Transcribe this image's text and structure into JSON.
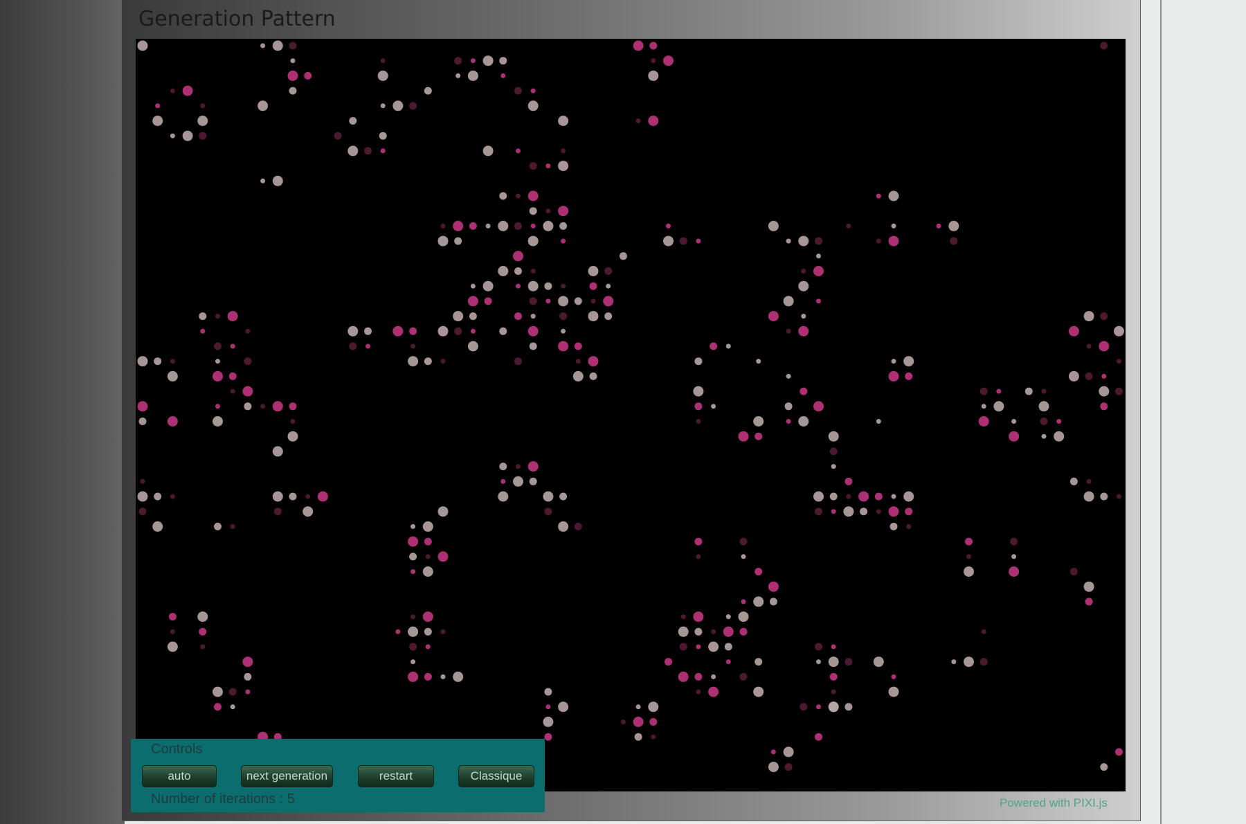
{
  "panel": {
    "title": "Generation Pattern"
  },
  "controls": {
    "title": "Controls",
    "buttons": {
      "auto": "auto",
      "next": "next generation",
      "restart": "restart",
      "mode": "Classique"
    },
    "iterations_label": "Number of iterations : 5"
  },
  "footer": {
    "powered": "Powered with PIXI.js"
  },
  "colors": {
    "board": "#000000",
    "controls_bg": "#0b6d6d",
    "cell_grey": "#b8a6a6",
    "cell_pink": "#c0357f",
    "cell_dark": "#5a1d3a"
  },
  "cells": [
    [
      0,
      0
    ],
    [
      8,
      0
    ],
    [
      9,
      0
    ],
    [
      10,
      0
    ],
    [
      33,
      0
    ],
    [
      34,
      0
    ],
    [
      64,
      0
    ],
    [
      10,
      1
    ],
    [
      16,
      1
    ],
    [
      21,
      1
    ],
    [
      22,
      1
    ],
    [
      23,
      1
    ],
    [
      24,
      1
    ],
    [
      34,
      1
    ],
    [
      35,
      1
    ],
    [
      10,
      2
    ],
    [
      11,
      2
    ],
    [
      16,
      2
    ],
    [
      21,
      2
    ],
    [
      22,
      2
    ],
    [
      24,
      2
    ],
    [
      34,
      2
    ],
    [
      2,
      3
    ],
    [
      3,
      3
    ],
    [
      10,
      3
    ],
    [
      19,
      3
    ],
    [
      25,
      3
    ],
    [
      26,
      3
    ],
    [
      1,
      4
    ],
    [
      4,
      4
    ],
    [
      8,
      4
    ],
    [
      16,
      4
    ],
    [
      17,
      4
    ],
    [
      18,
      4
    ],
    [
      26,
      4
    ],
    [
      1,
      5
    ],
    [
      4,
      5
    ],
    [
      14,
      5
    ],
    [
      28,
      5
    ],
    [
      33,
      5
    ],
    [
      34,
      5
    ],
    [
      2,
      6
    ],
    [
      3,
      6
    ],
    [
      4,
      6
    ],
    [
      13,
      6
    ],
    [
      16,
      6
    ],
    [
      14,
      7
    ],
    [
      15,
      7
    ],
    [
      16,
      7
    ],
    [
      23,
      7
    ],
    [
      25,
      7
    ],
    [
      28,
      7
    ],
    [
      26,
      8
    ],
    [
      27,
      8
    ],
    [
      28,
      8
    ],
    [
      8,
      9
    ],
    [
      9,
      9
    ],
    [
      24,
      10
    ],
    [
      25,
      10
    ],
    [
      26,
      10
    ],
    [
      49,
      10
    ],
    [
      50,
      10
    ],
    [
      26,
      11
    ],
    [
      27,
      11
    ],
    [
      28,
      11
    ],
    [
      20,
      12
    ],
    [
      21,
      12
    ],
    [
      22,
      12
    ],
    [
      23,
      12
    ],
    [
      24,
      12
    ],
    [
      25,
      12
    ],
    [
      26,
      12
    ],
    [
      27,
      12
    ],
    [
      28,
      12
    ],
    [
      35,
      12
    ],
    [
      42,
      12
    ],
    [
      47,
      12
    ],
    [
      50,
      12
    ],
    [
      53,
      12
    ],
    [
      54,
      12
    ],
    [
      20,
      13
    ],
    [
      21,
      13
    ],
    [
      26,
      13
    ],
    [
      28,
      13
    ],
    [
      35,
      13
    ],
    [
      36,
      13
    ],
    [
      37,
      13
    ],
    [
      43,
      13
    ],
    [
      44,
      13
    ],
    [
      45,
      13
    ],
    [
      49,
      13
    ],
    [
      50,
      13
    ],
    [
      54,
      13
    ],
    [
      25,
      14
    ],
    [
      32,
      14
    ],
    [
      45,
      14
    ],
    [
      24,
      15
    ],
    [
      25,
      15
    ],
    [
      26,
      15
    ],
    [
      30,
      15
    ],
    [
      31,
      15
    ],
    [
      44,
      15
    ],
    [
      45,
      15
    ],
    [
      22,
      16
    ],
    [
      23,
      16
    ],
    [
      25,
      16
    ],
    [
      26,
      16
    ],
    [
      27,
      16
    ],
    [
      28,
      16
    ],
    [
      30,
      16
    ],
    [
      31,
      16
    ],
    [
      44,
      16
    ],
    [
      22,
      17
    ],
    [
      23,
      17
    ],
    [
      26,
      17
    ],
    [
      27,
      17
    ],
    [
      28,
      17
    ],
    [
      29,
      17
    ],
    [
      30,
      17
    ],
    [
      31,
      17
    ],
    [
      43,
      17
    ],
    [
      45,
      17
    ],
    [
      4,
      18
    ],
    [
      5,
      18
    ],
    [
      6,
      18
    ],
    [
      21,
      18
    ],
    [
      22,
      18
    ],
    [
      25,
      18
    ],
    [
      26,
      18
    ],
    [
      28,
      18
    ],
    [
      30,
      18
    ],
    [
      31,
      18
    ],
    [
      42,
      18
    ],
    [
      44,
      18
    ],
    [
      63,
      18
    ],
    [
      64,
      18
    ],
    [
      4,
      19
    ],
    [
      7,
      19
    ],
    [
      14,
      19
    ],
    [
      15,
      19
    ],
    [
      17,
      19
    ],
    [
      18,
      19
    ],
    [
      20,
      19
    ],
    [
      21,
      19
    ],
    [
      22,
      19
    ],
    [
      24,
      19
    ],
    [
      26,
      19
    ],
    [
      28,
      19
    ],
    [
      43,
      19
    ],
    [
      44,
      19
    ],
    [
      62,
      19
    ],
    [
      65,
      19
    ],
    [
      5,
      20
    ],
    [
      6,
      20
    ],
    [
      14,
      20
    ],
    [
      15,
      20
    ],
    [
      18,
      20
    ],
    [
      22,
      20
    ],
    [
      26,
      20
    ],
    [
      28,
      20
    ],
    [
      29,
      20
    ],
    [
      38,
      20
    ],
    [
      39,
      20
    ],
    [
      63,
      20
    ],
    [
      64,
      20
    ],
    [
      0,
      21
    ],
    [
      1,
      21
    ],
    [
      2,
      21
    ],
    [
      5,
      21
    ],
    [
      7,
      21
    ],
    [
      18,
      21
    ],
    [
      19,
      21
    ],
    [
      20,
      21
    ],
    [
      25,
      21
    ],
    [
      29,
      21
    ],
    [
      30,
      21
    ],
    [
      37,
      21
    ],
    [
      41,
      21
    ],
    [
      50,
      21
    ],
    [
      51,
      21
    ],
    [
      65,
      21
    ],
    [
      2,
      22
    ],
    [
      5,
      22
    ],
    [
      6,
      22
    ],
    [
      29,
      22
    ],
    [
      30,
      22
    ],
    [
      43,
      22
    ],
    [
      50,
      22
    ],
    [
      51,
      22
    ],
    [
      62,
      22
    ],
    [
      63,
      22
    ],
    [
      64,
      22
    ],
    [
      6,
      23
    ],
    [
      7,
      23
    ],
    [
      37,
      23
    ],
    [
      44,
      23
    ],
    [
      56,
      23
    ],
    [
      57,
      23
    ],
    [
      59,
      23
    ],
    [
      60,
      23
    ],
    [
      64,
      23
    ],
    [
      65,
      23
    ],
    [
      0,
      24
    ],
    [
      5,
      24
    ],
    [
      7,
      24
    ],
    [
      8,
      24
    ],
    [
      9,
      24
    ],
    [
      10,
      24
    ],
    [
      37,
      24
    ],
    [
      38,
      24
    ],
    [
      43,
      24
    ],
    [
      45,
      24
    ],
    [
      56,
      24
    ],
    [
      57,
      24
    ],
    [
      60,
      24
    ],
    [
      64,
      24
    ],
    [
      0,
      25
    ],
    [
      2,
      25
    ],
    [
      5,
      25
    ],
    [
      10,
      25
    ],
    [
      37,
      25
    ],
    [
      41,
      25
    ],
    [
      43,
      25
    ],
    [
      44,
      25
    ],
    [
      49,
      25
    ],
    [
      56,
      25
    ],
    [
      58,
      25
    ],
    [
      60,
      25
    ],
    [
      61,
      25
    ],
    [
      10,
      26
    ],
    [
      40,
      26
    ],
    [
      41,
      26
    ],
    [
      46,
      26
    ],
    [
      58,
      26
    ],
    [
      60,
      26
    ],
    [
      61,
      26
    ],
    [
      9,
      27
    ],
    [
      46,
      27
    ],
    [
      24,
      28
    ],
    [
      25,
      28
    ],
    [
      26,
      28
    ],
    [
      46,
      28
    ],
    [
      0,
      29
    ],
    [
      24,
      29
    ],
    [
      25,
      29
    ],
    [
      26,
      29
    ],
    [
      47,
      29
    ],
    [
      62,
      29
    ],
    [
      63,
      29
    ],
    [
      0,
      30
    ],
    [
      1,
      30
    ],
    [
      2,
      30
    ],
    [
      9,
      30
    ],
    [
      10,
      30
    ],
    [
      11,
      30
    ],
    [
      12,
      30
    ],
    [
      24,
      30
    ],
    [
      27,
      30
    ],
    [
      28,
      30
    ],
    [
      45,
      30
    ],
    [
      46,
      30
    ],
    [
      47,
      30
    ],
    [
      48,
      30
    ],
    [
      49,
      30
    ],
    [
      50,
      30
    ],
    [
      51,
      30
    ],
    [
      63,
      30
    ],
    [
      64,
      30
    ],
    [
      65,
      30
    ],
    [
      0,
      31
    ],
    [
      9,
      31
    ],
    [
      11,
      31
    ],
    [
      20,
      31
    ],
    [
      27,
      31
    ],
    [
      45,
      31
    ],
    [
      46,
      31
    ],
    [
      47,
      31
    ],
    [
      48,
      31
    ],
    [
      49,
      31
    ],
    [
      50,
      31
    ],
    [
      51,
      31
    ],
    [
      1,
      32
    ],
    [
      5,
      32
    ],
    [
      6,
      32
    ],
    [
      18,
      32
    ],
    [
      19,
      32
    ],
    [
      28,
      32
    ],
    [
      29,
      32
    ],
    [
      50,
      32
    ],
    [
      51,
      32
    ],
    [
      18,
      33
    ],
    [
      19,
      33
    ],
    [
      37,
      33
    ],
    [
      40,
      33
    ],
    [
      55,
      33
    ],
    [
      58,
      33
    ],
    [
      18,
      34
    ],
    [
      19,
      34
    ],
    [
      20,
      34
    ],
    [
      37,
      34
    ],
    [
      40,
      34
    ],
    [
      55,
      34
    ],
    [
      58,
      34
    ],
    [
      18,
      35
    ],
    [
      19,
      35
    ],
    [
      41,
      35
    ],
    [
      55,
      35
    ],
    [
      58,
      35
    ],
    [
      62,
      35
    ],
    [
      42,
      36
    ],
    [
      63,
      36
    ],
    [
      40,
      37
    ],
    [
      41,
      37
    ],
    [
      42,
      37
    ],
    [
      63,
      37
    ],
    [
      2,
      38
    ],
    [
      4,
      38
    ],
    [
      36,
      38
    ],
    [
      37,
      38
    ],
    [
      39,
      38
    ],
    [
      40,
      38
    ],
    [
      2,
      39
    ],
    [
      4,
      39
    ],
    [
      36,
      39
    ],
    [
      37,
      39
    ],
    [
      38,
      39
    ],
    [
      39,
      39
    ],
    [
      40,
      39
    ],
    [
      56,
      39
    ],
    [
      2,
      40
    ],
    [
      4,
      40
    ],
    [
      36,
      40
    ],
    [
      37,
      40
    ],
    [
      38,
      40
    ],
    [
      39,
      40
    ],
    [
      45,
      40
    ],
    [
      46,
      40
    ],
    [
      7,
      41
    ],
    [
      35,
      41
    ],
    [
      39,
      41
    ],
    [
      41,
      41
    ],
    [
      45,
      41
    ],
    [
      46,
      41
    ],
    [
      47,
      41
    ],
    [
      49,
      41
    ],
    [
      54,
      41
    ],
    [
      55,
      41
    ],
    [
      56,
      41
    ],
    [
      7,
      42
    ],
    [
      36,
      42
    ],
    [
      37,
      42
    ],
    [
      38,
      42
    ],
    [
      40,
      42
    ],
    [
      46,
      42
    ],
    [
      50,
      42
    ],
    [
      5,
      43
    ],
    [
      6,
      43
    ],
    [
      7,
      43
    ],
    [
      37,
      43
    ],
    [
      38,
      43
    ],
    [
      46,
      43
    ],
    [
      50,
      43
    ],
    [
      5,
      44
    ],
    [
      6,
      44
    ],
    [
      46,
      44
    ],
    [
      47,
      44
    ],
    [
      18,
      38
    ],
    [
      19,
      38
    ],
    [
      17,
      39
    ],
    [
      18,
      39
    ],
    [
      19,
      39
    ],
    [
      20,
      39
    ],
    [
      18,
      40
    ],
    [
      19,
      40
    ],
    [
      18,
      41
    ],
    [
      18,
      42
    ],
    [
      19,
      42
    ],
    [
      20,
      42
    ],
    [
      21,
      42
    ],
    [
      27,
      43
    ],
    [
      41,
      43
    ],
    [
      27,
      44
    ],
    [
      28,
      44
    ],
    [
      33,
      44
    ],
    [
      34,
      44
    ],
    [
      44,
      44
    ],
    [
      45,
      44
    ],
    [
      46,
      44
    ],
    [
      27,
      45
    ],
    [
      32,
      45
    ],
    [
      33,
      45
    ],
    [
      34,
      45
    ],
    [
      27,
      46
    ],
    [
      33,
      46
    ],
    [
      34,
      46
    ],
    [
      45,
      46
    ],
    [
      8,
      46
    ],
    [
      9,
      46
    ],
    [
      42,
      47
    ],
    [
      43,
      47
    ],
    [
      65,
      47
    ],
    [
      42,
      48
    ],
    [
      43,
      48
    ],
    [
      64,
      48
    ]
  ]
}
